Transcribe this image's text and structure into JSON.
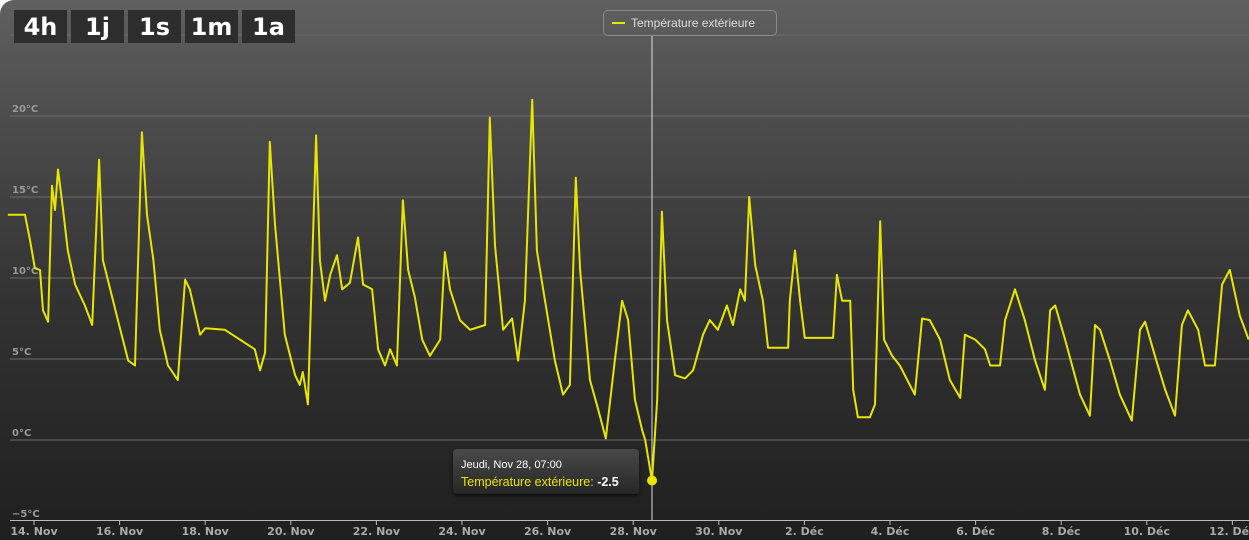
{
  "range_buttons": [
    {
      "label": "4h"
    },
    {
      "label": "1j"
    },
    {
      "label": "1s"
    },
    {
      "label": "1m"
    },
    {
      "label": "1a"
    }
  ],
  "tooltip": {
    "date": "Jeudi, Nov 28, 07:00",
    "series": "Température extérieure:",
    "value": "-2.5"
  },
  "chart_data": {
    "type": "line",
    "title": "",
    "xlabel": "",
    "ylabel": "",
    "x_unit": "days since 14 Nov 00:00",
    "xlim": [
      -0.61,
      28.38
    ],
    "ylim": [
      -5,
      25
    ],
    "grid": true,
    "legend": {
      "placement": "top-center",
      "entries": [
        "Température extérieure"
      ]
    },
    "y_ticks": [
      {
        "v": -5,
        "label": "-5°C"
      },
      {
        "v": 0,
        "label": "0°C"
      },
      {
        "v": 5,
        "label": "5°C"
      },
      {
        "v": 10,
        "label": "10°C"
      },
      {
        "v": 15,
        "label": "15°C"
      },
      {
        "v": 20,
        "label": "20°C"
      }
    ],
    "x_ticks": [
      {
        "v": 0,
        "label": "14. Nov"
      },
      {
        "v": 2,
        "label": "16. Nov"
      },
      {
        "v": 4,
        "label": "18. Nov"
      },
      {
        "v": 6,
        "label": "20. Nov"
      },
      {
        "v": 8,
        "label": "22. Nov"
      },
      {
        "v": 10,
        "label": "24. Nov"
      },
      {
        "v": 12,
        "label": "26. Nov"
      },
      {
        "v": 14,
        "label": "28. Nov"
      },
      {
        "v": 16,
        "label": "30. Nov"
      },
      {
        "v": 18,
        "label": "2. Déc"
      },
      {
        "v": 20,
        "label": "4. Déc"
      },
      {
        "v": 22,
        "label": "6. Déc"
      },
      {
        "v": 24,
        "label": "8. Déc"
      },
      {
        "v": 26,
        "label": "10. Déc"
      },
      {
        "v": 28,
        "label": "12. Déc"
      }
    ],
    "highlight": {
      "x": 14.44,
      "y": -2.5
    },
    "series": [
      {
        "name": "Température extérieure",
        "color": "#e6e600",
        "points": [
          [
            -0.61,
            13.9
          ],
          [
            -0.21,
            13.9
          ],
          [
            -0.09,
            12.3
          ],
          [
            0.02,
            10.6
          ],
          [
            0.14,
            10.5
          ],
          [
            0.21,
            8.0
          ],
          [
            0.33,
            7.3
          ],
          [
            0.42,
            15.7
          ],
          [
            0.49,
            14.2
          ],
          [
            0.56,
            16.7
          ],
          [
            0.68,
            14.2
          ],
          [
            0.79,
            11.7
          ],
          [
            0.96,
            9.6
          ],
          [
            1.19,
            8.3
          ],
          [
            1.36,
            7.1
          ],
          [
            1.52,
            17.3
          ],
          [
            1.61,
            11.1
          ],
          [
            1.78,
            9.3
          ],
          [
            1.96,
            7.4
          ],
          [
            2.2,
            4.9
          ],
          [
            2.36,
            4.6
          ],
          [
            2.52,
            19.0
          ],
          [
            2.64,
            13.9
          ],
          [
            2.79,
            11.1
          ],
          [
            2.94,
            6.8
          ],
          [
            3.13,
            4.6
          ],
          [
            3.36,
            3.7
          ],
          [
            3.53,
            9.9
          ],
          [
            3.64,
            9.3
          ],
          [
            3.88,
            6.5
          ],
          [
            4.0,
            6.9
          ],
          [
            4.46,
            6.8
          ],
          [
            5.16,
            5.6
          ],
          [
            5.28,
            4.3
          ],
          [
            5.4,
            5.4
          ],
          [
            5.51,
            18.4
          ],
          [
            5.63,
            13.3
          ],
          [
            5.86,
            6.5
          ],
          [
            6.1,
            4.0
          ],
          [
            6.21,
            3.4
          ],
          [
            6.28,
            4.2
          ],
          [
            6.4,
            2.2
          ],
          [
            6.59,
            18.8
          ],
          [
            6.68,
            11.1
          ],
          [
            6.8,
            8.6
          ],
          [
            6.92,
            10.2
          ],
          [
            7.08,
            11.4
          ],
          [
            7.2,
            9.3
          ],
          [
            7.38,
            9.7
          ],
          [
            7.57,
            12.5
          ],
          [
            7.69,
            9.6
          ],
          [
            7.9,
            9.3
          ],
          [
            8.04,
            5.6
          ],
          [
            8.2,
            4.6
          ],
          [
            8.32,
            5.6
          ],
          [
            8.48,
            4.6
          ],
          [
            8.62,
            14.8
          ],
          [
            8.74,
            10.5
          ],
          [
            8.9,
            8.8
          ],
          [
            9.07,
            6.2
          ],
          [
            9.25,
            5.2
          ],
          [
            9.49,
            6.2
          ],
          [
            9.6,
            11.6
          ],
          [
            9.72,
            9.3
          ],
          [
            9.95,
            7.4
          ],
          [
            10.19,
            6.8
          ],
          [
            10.54,
            7.1
          ],
          [
            10.65,
            19.9
          ],
          [
            10.77,
            12.0
          ],
          [
            10.96,
            6.8
          ],
          [
            11.17,
            7.5
          ],
          [
            11.31,
            4.9
          ],
          [
            11.47,
            8.6
          ],
          [
            11.64,
            21.0
          ],
          [
            11.75,
            11.7
          ],
          [
            11.94,
            8.6
          ],
          [
            12.17,
            4.9
          ],
          [
            12.36,
            2.8
          ],
          [
            12.52,
            3.4
          ],
          [
            12.66,
            16.2
          ],
          [
            12.76,
            10.5
          ],
          [
            12.99,
            3.7
          ],
          [
            13.18,
            1.9
          ],
          [
            13.36,
            0.1
          ],
          [
            13.57,
            4.9
          ],
          [
            13.74,
            8.6
          ],
          [
            13.88,
            7.4
          ],
          [
            14.04,
            2.5
          ],
          [
            14.21,
            0.6
          ],
          [
            14.28,
            0
          ],
          [
            14.44,
            -2.5
          ],
          [
            14.56,
            2.5
          ],
          [
            14.67,
            14.1
          ],
          [
            14.79,
            7.4
          ],
          [
            14.98,
            4.0
          ],
          [
            15.21,
            3.8
          ],
          [
            15.4,
            4.3
          ],
          [
            15.63,
            6.5
          ],
          [
            15.79,
            7.4
          ],
          [
            15.98,
            6.8
          ],
          [
            16.19,
            8.3
          ],
          [
            16.33,
            7.1
          ],
          [
            16.5,
            9.3
          ],
          [
            16.61,
            8.6
          ],
          [
            16.71,
            15.0
          ],
          [
            16.85,
            10.8
          ],
          [
            17.03,
            8.6
          ],
          [
            17.15,
            5.7
          ],
          [
            17.62,
            5.7
          ],
          [
            17.66,
            8.6
          ],
          [
            17.78,
            11.7
          ],
          [
            17.9,
            8.6
          ],
          [
            18.01,
            6.3
          ],
          [
            18.67,
            6.3
          ],
          [
            18.76,
            10.2
          ],
          [
            18.88,
            8.6
          ],
          [
            19.07,
            8.6
          ],
          [
            19.14,
            3.1
          ],
          [
            19.25,
            1.4
          ],
          [
            19.53,
            1.4
          ],
          [
            19.65,
            2.2
          ],
          [
            19.77,
            13.5
          ],
          [
            19.86,
            6.2
          ],
          [
            20.05,
            5.2
          ],
          [
            20.23,
            4.6
          ],
          [
            20.58,
            2.8
          ],
          [
            20.75,
            7.5
          ],
          [
            20.93,
            7.4
          ],
          [
            21.17,
            6.2
          ],
          [
            21.4,
            3.7
          ],
          [
            21.64,
            2.6
          ],
          [
            21.75,
            6.5
          ],
          [
            21.99,
            6.2
          ],
          [
            22.22,
            5.6
          ],
          [
            22.34,
            4.6
          ],
          [
            22.57,
            4.6
          ],
          [
            22.69,
            7.4
          ],
          [
            22.92,
            9.3
          ],
          [
            23.15,
            7.4
          ],
          [
            23.39,
            4.9
          ],
          [
            23.62,
            3.1
          ],
          [
            23.74,
            8.0
          ],
          [
            23.86,
            8.3
          ],
          [
            24.09,
            6.2
          ],
          [
            24.44,
            2.8
          ],
          [
            24.67,
            1.5
          ],
          [
            24.79,
            7.1
          ],
          [
            24.91,
            6.8
          ],
          [
            25.14,
            4.9
          ],
          [
            25.37,
            2.8
          ],
          [
            25.65,
            1.2
          ],
          [
            25.84,
            6.8
          ],
          [
            25.96,
            7.3
          ],
          [
            26.19,
            5.2
          ],
          [
            26.43,
            3.1
          ],
          [
            26.66,
            1.5
          ],
          [
            26.82,
            7.1
          ],
          [
            26.96,
            8.0
          ],
          [
            27.2,
            6.8
          ],
          [
            27.36,
            4.6
          ],
          [
            27.59,
            4.6
          ],
          [
            27.76,
            9.6
          ],
          [
            27.94,
            10.5
          ],
          [
            28.17,
            7.7
          ],
          [
            28.38,
            6.2
          ]
        ]
      }
    ]
  }
}
